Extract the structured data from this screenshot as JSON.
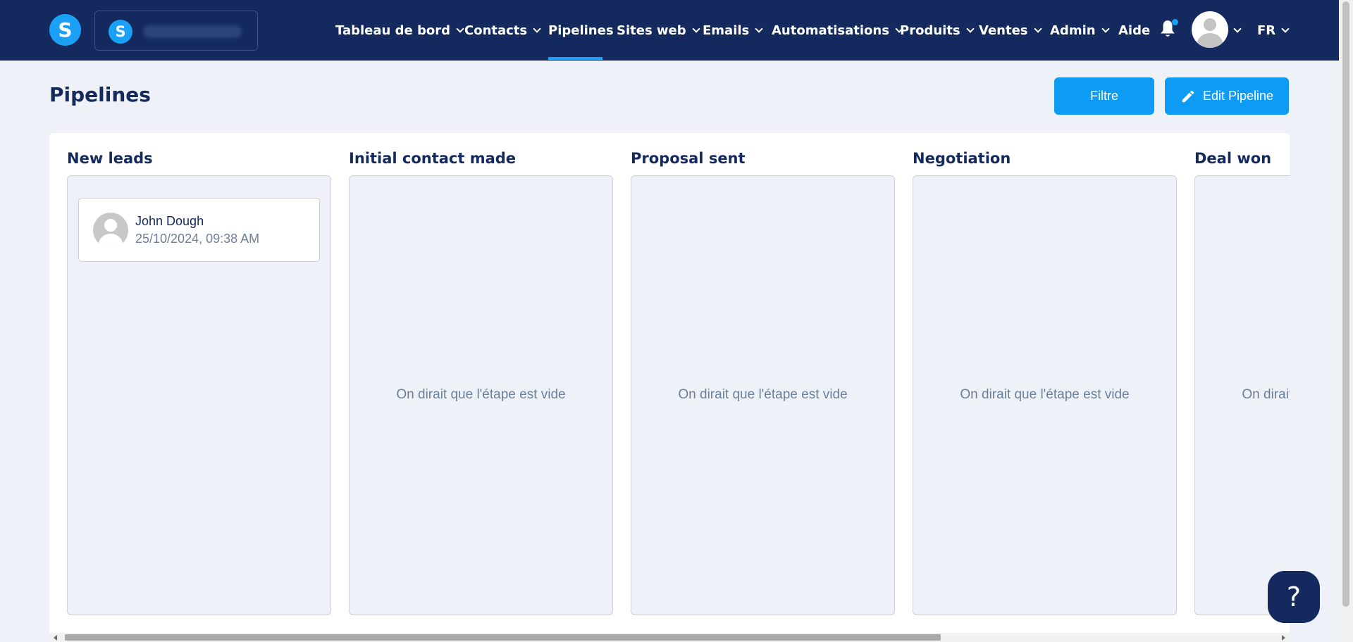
{
  "app": {
    "logo_letter": "S",
    "workspace_logo_letter": "S",
    "accent_color": "#1aa0f5",
    "nav_background": "#142a5e"
  },
  "nav": {
    "items": [
      {
        "label": "Tableau de bord",
        "has_dropdown": true
      },
      {
        "label": "Contacts",
        "has_dropdown": true
      },
      {
        "label": "Pipelines",
        "has_dropdown": false,
        "active": true
      },
      {
        "label": "Sites web",
        "has_dropdown": true
      },
      {
        "label": "Emails",
        "has_dropdown": true
      },
      {
        "label": "Automatisations",
        "has_dropdown": true
      },
      {
        "label": "Produits",
        "has_dropdown": true
      },
      {
        "label": "Ventes",
        "has_dropdown": true
      },
      {
        "label": "Admin",
        "has_dropdown": true
      },
      {
        "label": "Aide",
        "has_dropdown": false
      }
    ],
    "bell_icon": "bell-icon",
    "language": "FR"
  },
  "page": {
    "title": "Pipelines",
    "filter_label": "Filtre",
    "edit_label": "Edit Pipeline"
  },
  "stages": [
    {
      "title": "New leads",
      "empty_text": ""
    },
    {
      "title": "Initial contact made",
      "empty_text": "On dirait que l'étape est vide"
    },
    {
      "title": "Proposal sent",
      "empty_text": "On dirait que l'étape est vide"
    },
    {
      "title": "Negotiation",
      "empty_text": "On dirait que l'étape est vide"
    },
    {
      "title": "Deal won",
      "empty_text": "On dirait que l'étape est vide"
    }
  ],
  "deal_card": {
    "name": "John Dough",
    "date": "25/10/2024, 09:38 AM"
  },
  "help": {
    "label": "?"
  }
}
